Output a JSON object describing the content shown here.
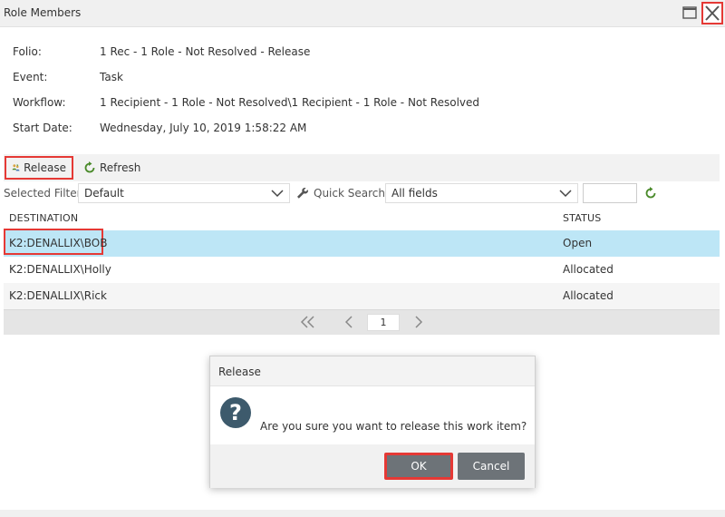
{
  "window": {
    "title": "Role Members"
  },
  "info": {
    "folio": {
      "label": "Folio:",
      "value": "1 Rec - 1 Role - Not Resolved - Release"
    },
    "event": {
      "label": "Event:",
      "value": "Task"
    },
    "workflow": {
      "label": "Workflow:",
      "value": "1 Recipient - 1 Role - Not Resolved\\1 Recipient - 1 Role - Not Resolved"
    },
    "start_date": {
      "label": "Start Date:",
      "value": "Wednesday, July 10, 2019 1:58:22 AM"
    }
  },
  "toolbar": {
    "release_label": "Release",
    "refresh_label": "Refresh"
  },
  "filters": {
    "selected_filter_label": "Selected Filter:",
    "selected_filter_value": "Default",
    "quick_search_label": "Quick Search:",
    "quick_search_value": "All fields",
    "search_text": ""
  },
  "grid": {
    "columns": [
      "DESTINATION",
      "STATUS"
    ],
    "rows": [
      {
        "destination": "K2:DENALLIX\\BOB",
        "status": "Open"
      },
      {
        "destination": "K2:DENALLIX\\Holly",
        "status": "Allocated"
      },
      {
        "destination": "K2:DENALLIX\\Rick",
        "status": "Allocated"
      }
    ],
    "page": "1"
  },
  "dialog": {
    "title": "Release",
    "message": "Are you sure you want to release this work item?",
    "ok_label": "OK",
    "cancel_label": "Cancel"
  },
  "colors": {
    "highlight": "#e53935",
    "selected_row": "#bde6f6",
    "dialog_button": "#6d7378",
    "icon_primary": "#3d5a6c",
    "refresh_green": "#4a8a2a"
  }
}
